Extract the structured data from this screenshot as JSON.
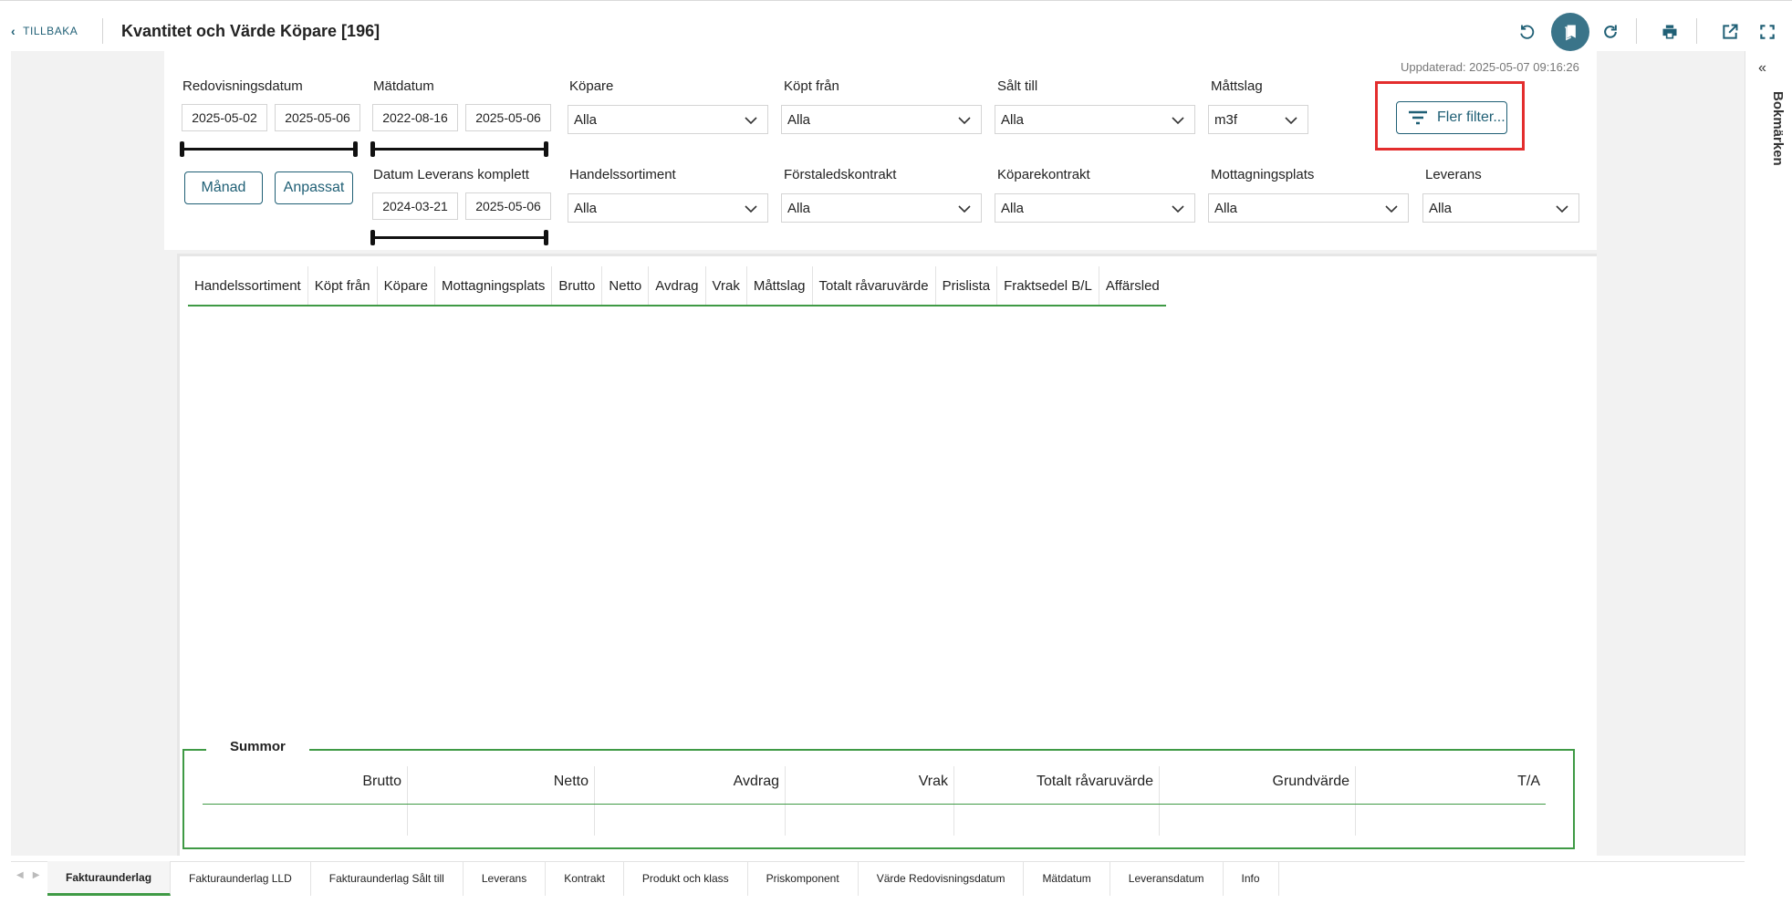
{
  "header": {
    "back_label": "TILLBAKA",
    "title": "Kvantitet och Värde Köpare [196]",
    "tools": [
      "reset-icon",
      "bookmark-icon",
      "reload-icon",
      "print-icon",
      "external-link-icon",
      "fullscreen-icon"
    ]
  },
  "updated": "Uppdaterad: 2025-05-07 09:16:26",
  "filters": {
    "redovisningsdatum": {
      "label": "Redovisningsdatum",
      "from": "2025-05-02",
      "to": "2025-05-06"
    },
    "matdatum": {
      "label": "Mätdatum",
      "from": "2022-08-16",
      "to": "2025-05-06"
    },
    "leverans_komplett": {
      "label": "Datum Leverans komplett",
      "from": "2024-03-21",
      "to": "2025-05-06"
    },
    "manad_button": "Månad",
    "anpassat_button": "Anpassat",
    "kopare": {
      "label": "Köpare",
      "value": "Alla"
    },
    "kopt_fran": {
      "label": "Köpt från",
      "value": "Alla"
    },
    "salt_till": {
      "label": "Sålt till",
      "value": "Alla"
    },
    "mattslag": {
      "label": "Måttslag",
      "value": "m3f"
    },
    "handelssortiment": {
      "label": "Handelssortiment",
      "value": "Alla"
    },
    "forstaledskontrakt": {
      "label": "Förstaledskontrakt",
      "value": "Alla"
    },
    "koparekontrakt": {
      "label": "Köparekontrakt",
      "value": "Alla"
    },
    "mottagningsplats": {
      "label": "Mottagningsplats",
      "value": "Alla"
    },
    "leverans": {
      "label": "Leverans",
      "value": "Alla"
    },
    "more_filters": "Fler filter..."
  },
  "table": {
    "columns": [
      "Handelssortiment",
      "Köpt från",
      "Köpare",
      "Mottagningsplats",
      "Brutto",
      "Netto",
      "Avdrag",
      "Vrak",
      "Måttslag",
      "Totalt råvaruvärde",
      "Prislista",
      "Fraktsedel B/L",
      "Affärsled"
    ]
  },
  "summary": {
    "legend": "Summor",
    "columns": [
      "Brutto",
      "Netto",
      "Avdrag",
      "Vrak",
      "Totalt råvaruvärde",
      "Grundvärde",
      "T/A"
    ]
  },
  "bookmarks": {
    "label": "Bokmärken",
    "collapse": "«"
  },
  "tabs": [
    "Fakturaunderlag",
    "Fakturaunderlag LLD",
    "Fakturaunderlag Sålt till",
    "Leverans",
    "Kontrakt",
    "Produkt och klass",
    "Priskomponent",
    "Värde Redovisningsdatum",
    "Mätdatum",
    "Leveransdatum",
    "Info"
  ],
  "active_tab": "Fakturaunderlag"
}
